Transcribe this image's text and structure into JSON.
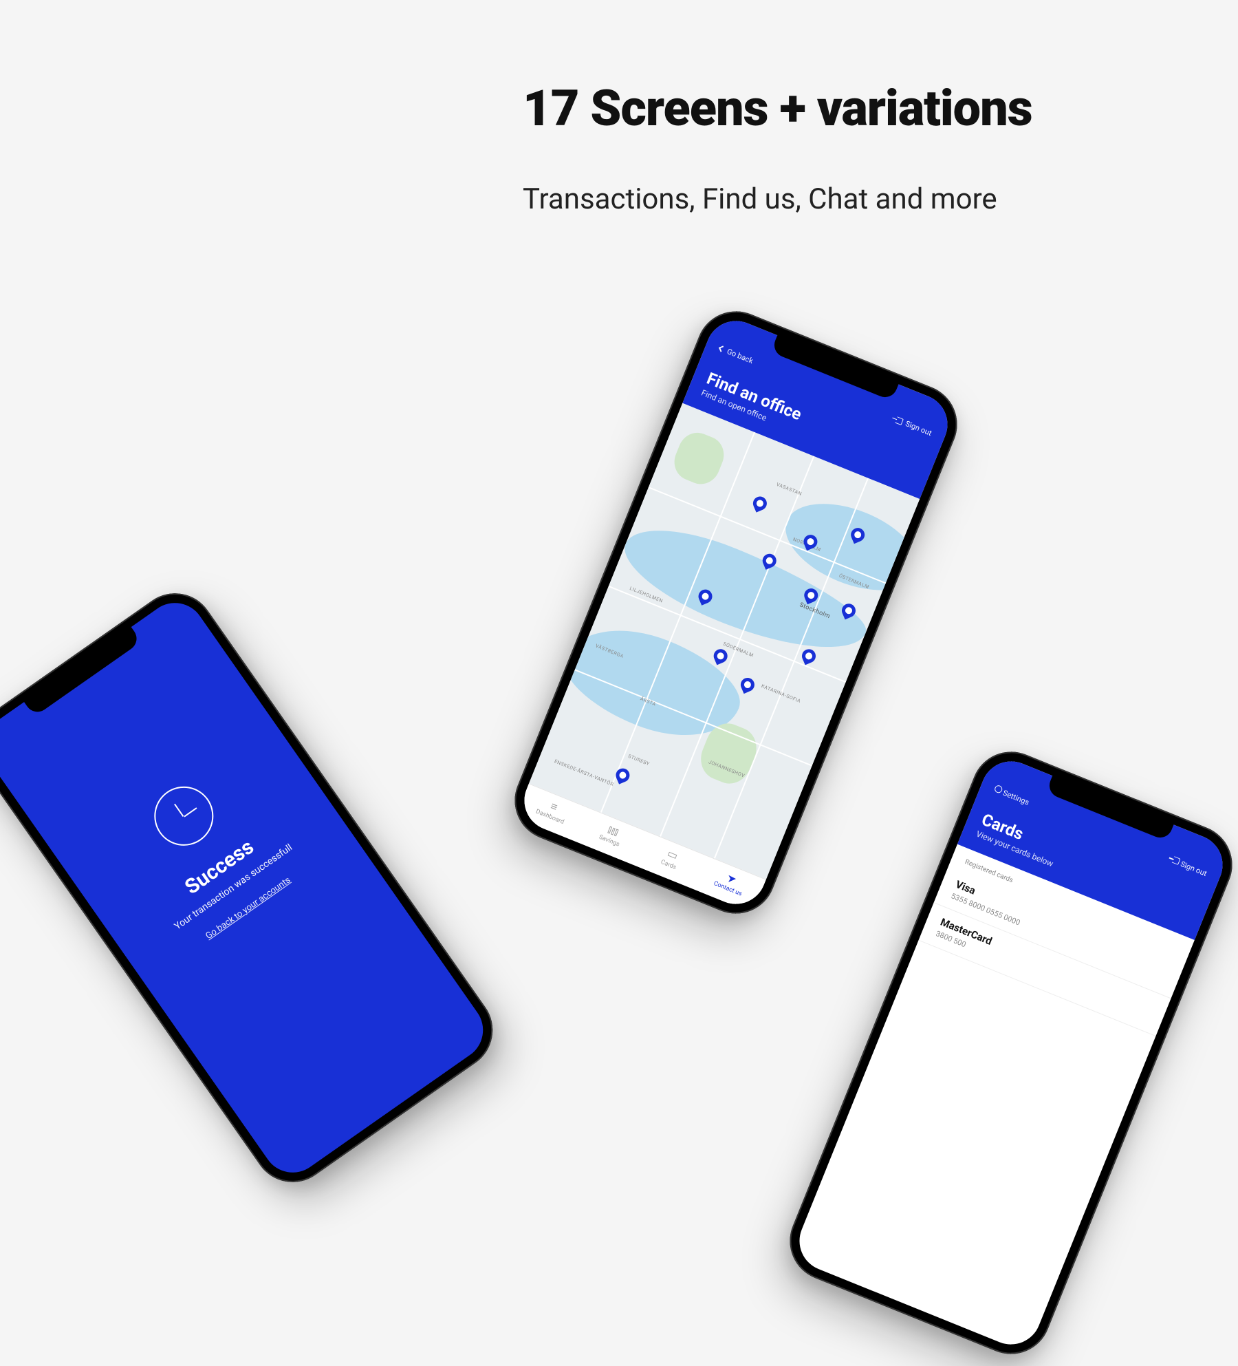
{
  "headline": "17 Screens + variations",
  "subline": "Transactions, Find us, Chat and more",
  "colors": {
    "accent": "#1830d6"
  },
  "success": {
    "title": "Success",
    "message": "Your transaction was successfull",
    "back_link": "Go back to your accounts"
  },
  "map": {
    "back_label": "Go back",
    "signout_label": "Sign out",
    "title": "Find an office",
    "subtitle": "Find an open office",
    "city_label": "Stockholm",
    "districts": [
      "VASASTAN",
      "NORRMALM",
      "ÖSTERMALM",
      "SÖDERMALM",
      "KATARINA-SOFIA",
      "JOHANNESHOV",
      "LILJEHOLMEN",
      "STUREBY",
      "ÅRSTA",
      "ENSKEDE-ÅRSTA-VANTÖR",
      "VÄSTBERGA"
    ],
    "tabs": [
      {
        "id": "dashboard",
        "label": "Dashboard"
      },
      {
        "id": "savings",
        "label": "Savings"
      },
      {
        "id": "cards",
        "label": "Cards"
      },
      {
        "id": "contact",
        "label": "Contact us"
      }
    ],
    "active_tab": "contact"
  },
  "cards": {
    "settings_label": "Settings",
    "signout_label": "Sign out",
    "title": "Cards",
    "subtitle": "View your cards below",
    "section_label": "Registered cards",
    "items": [
      {
        "name": "Visa",
        "number": "5355 8000 0555 0000"
      },
      {
        "name": "MasterCard",
        "number": "3800 500"
      }
    ]
  }
}
